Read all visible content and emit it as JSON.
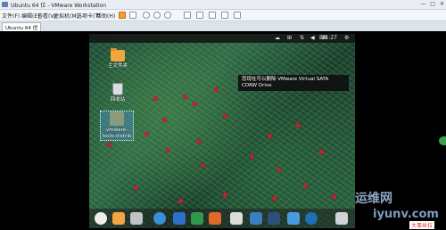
{
  "window": {
    "title": "Ubuntu 64 位 - VMware Workstation",
    "controls": [
      "—",
      "□",
      "✕"
    ]
  },
  "menubar": {
    "items": [
      "文件(F)",
      "编辑(E)",
      "查看(V)",
      "虚拟机(M)",
      "选项卡(T)",
      "帮助(H)"
    ]
  },
  "tabs": [
    {
      "label": "Ubuntu 64 位"
    }
  ],
  "guest": {
    "topbar": {
      "clock": "21:27"
    },
    "desktop_icons": [
      {
        "label": "主文件夹"
      },
      {
        "label": "回收站"
      },
      {
        "label": "vmware-tools-distrib"
      }
    ],
    "notification": {
      "text": "您现在可以删除 VMware Virtual SATA CDRW Drive"
    }
  },
  "watermark": {
    "line1": "运维网",
    "line2": "iyunv.com",
    "badge": "大事丝拉"
  }
}
